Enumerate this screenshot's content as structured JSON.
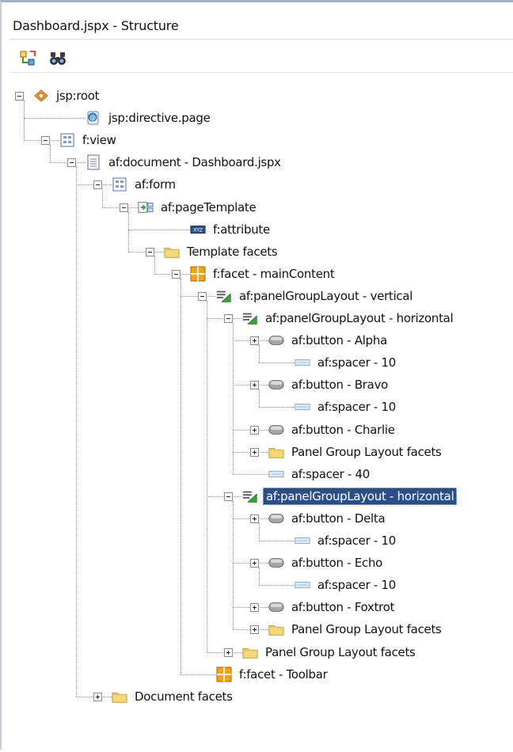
{
  "window": {
    "title": "Dashboard.jspx - Structure"
  },
  "toolbar": {
    "buttons": [
      "tree-structure-icon",
      "binoculars-icon"
    ]
  },
  "tree": {
    "nodes": [
      {
        "label": "jsp:root",
        "depth": 0,
        "icon": "jsp-root-icon",
        "toggle": "minus"
      },
      {
        "label": "jsp:directive.page",
        "depth": 2,
        "icon": "directive-icon",
        "toggle": "none"
      },
      {
        "label": "f:view",
        "depth": 1,
        "icon": "view-icon",
        "toggle": "minus"
      },
      {
        "label": "af:document - Dashboard.jspx",
        "depth": 2,
        "icon": "document-icon",
        "toggle": "minus"
      },
      {
        "label": "af:form",
        "depth": 3,
        "icon": "form-icon",
        "toggle": "minus"
      },
      {
        "label": "af:pageTemplate",
        "depth": 4,
        "icon": "page-template-icon",
        "toggle": "minus"
      },
      {
        "label": "f:attribute",
        "depth": 6,
        "icon": "attribute-icon",
        "toggle": "none"
      },
      {
        "label": "Template facets",
        "depth": 5,
        "icon": "folder-icon",
        "toggle": "minus"
      },
      {
        "label": "f:facet - mainContent",
        "depth": 6,
        "icon": "facet-icon",
        "toggle": "minus"
      },
      {
        "label": "af:panelGroupLayout - vertical",
        "depth": 7,
        "icon": "panel-group-layout-icon",
        "toggle": "minus"
      },
      {
        "label": "af:panelGroupLayout - horizontal",
        "depth": 8,
        "icon": "panel-group-layout-icon",
        "toggle": "minus"
      },
      {
        "label": "af:button - Alpha",
        "depth": 9,
        "icon": "button-icon",
        "toggle": "plus"
      },
      {
        "label": "af:spacer - 10",
        "depth": 10,
        "icon": "spacer-icon",
        "toggle": "none"
      },
      {
        "label": "af:button - Bravo",
        "depth": 9,
        "icon": "button-icon",
        "toggle": "plus"
      },
      {
        "label": "af:spacer - 10",
        "depth": 10,
        "icon": "spacer-icon",
        "toggle": "none"
      },
      {
        "label": "af:button - Charlie",
        "depth": 9,
        "icon": "button-icon",
        "toggle": "plus"
      },
      {
        "label": "Panel Group Layout facets",
        "depth": 9,
        "icon": "folder-icon",
        "toggle": "plus"
      },
      {
        "label": "af:spacer - 40",
        "depth": 9,
        "icon": "spacer-icon",
        "toggle": "none"
      },
      {
        "label": "af:panelGroupLayout - horizontal",
        "depth": 8,
        "icon": "panel-group-layout-icon",
        "toggle": "minus",
        "selected": true
      },
      {
        "label": "af:button - Delta",
        "depth": 9,
        "icon": "button-icon",
        "toggle": "plus"
      },
      {
        "label": "af:spacer - 10",
        "depth": 10,
        "icon": "spacer-icon",
        "toggle": "none"
      },
      {
        "label": "af:button - Echo",
        "depth": 9,
        "icon": "button-icon",
        "toggle": "plus"
      },
      {
        "label": "af:spacer - 10",
        "depth": 10,
        "icon": "spacer-icon",
        "toggle": "none"
      },
      {
        "label": "af:button - Foxtrot",
        "depth": 9,
        "icon": "button-icon",
        "toggle": "plus"
      },
      {
        "label": "Panel Group Layout facets",
        "depth": 9,
        "icon": "folder-icon",
        "toggle": "plus"
      },
      {
        "label": "Panel Group Layout facets",
        "depth": 8,
        "icon": "folder-icon",
        "toggle": "plus"
      },
      {
        "label": "f:facet - Toolbar",
        "depth": 7,
        "icon": "facet-icon",
        "toggle": "none"
      },
      {
        "label": "Document facets",
        "depth": 3,
        "icon": "folder-icon",
        "toggle": "plus"
      }
    ]
  },
  "colors": {
    "selection": "#2a4f86",
    "folder": "#f3d77a",
    "facet": "#f2a21b"
  }
}
